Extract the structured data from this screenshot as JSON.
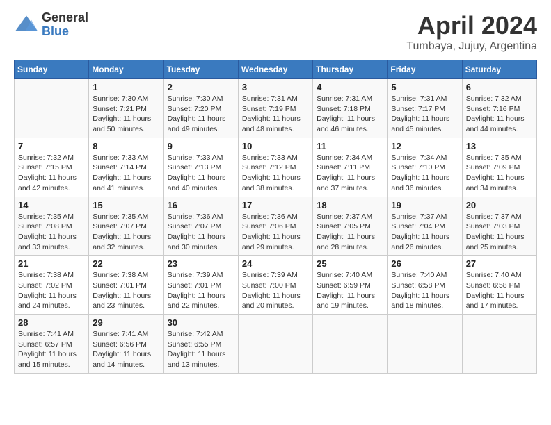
{
  "header": {
    "logo_general": "General",
    "logo_blue": "Blue",
    "month_title": "April 2024",
    "location": "Tumbaya, Jujuy, Argentina"
  },
  "days_of_week": [
    "Sunday",
    "Monday",
    "Tuesday",
    "Wednesday",
    "Thursday",
    "Friday",
    "Saturday"
  ],
  "weeks": [
    [
      {
        "day": "",
        "sunrise": "",
        "sunset": "",
        "daylight": ""
      },
      {
        "day": "1",
        "sunrise": "Sunrise: 7:30 AM",
        "sunset": "Sunset: 7:21 PM",
        "daylight": "Daylight: 11 hours and 50 minutes."
      },
      {
        "day": "2",
        "sunrise": "Sunrise: 7:30 AM",
        "sunset": "Sunset: 7:20 PM",
        "daylight": "Daylight: 11 hours and 49 minutes."
      },
      {
        "day": "3",
        "sunrise": "Sunrise: 7:31 AM",
        "sunset": "Sunset: 7:19 PM",
        "daylight": "Daylight: 11 hours and 48 minutes."
      },
      {
        "day": "4",
        "sunrise": "Sunrise: 7:31 AM",
        "sunset": "Sunset: 7:18 PM",
        "daylight": "Daylight: 11 hours and 46 minutes."
      },
      {
        "day": "5",
        "sunrise": "Sunrise: 7:31 AM",
        "sunset": "Sunset: 7:17 PM",
        "daylight": "Daylight: 11 hours and 45 minutes."
      },
      {
        "day": "6",
        "sunrise": "Sunrise: 7:32 AM",
        "sunset": "Sunset: 7:16 PM",
        "daylight": "Daylight: 11 hours and 44 minutes."
      }
    ],
    [
      {
        "day": "7",
        "sunrise": "Sunrise: 7:32 AM",
        "sunset": "Sunset: 7:15 PM",
        "daylight": "Daylight: 11 hours and 42 minutes."
      },
      {
        "day": "8",
        "sunrise": "Sunrise: 7:33 AM",
        "sunset": "Sunset: 7:14 PM",
        "daylight": "Daylight: 11 hours and 41 minutes."
      },
      {
        "day": "9",
        "sunrise": "Sunrise: 7:33 AM",
        "sunset": "Sunset: 7:13 PM",
        "daylight": "Daylight: 11 hours and 40 minutes."
      },
      {
        "day": "10",
        "sunrise": "Sunrise: 7:33 AM",
        "sunset": "Sunset: 7:12 PM",
        "daylight": "Daylight: 11 hours and 38 minutes."
      },
      {
        "day": "11",
        "sunrise": "Sunrise: 7:34 AM",
        "sunset": "Sunset: 7:11 PM",
        "daylight": "Daylight: 11 hours and 37 minutes."
      },
      {
        "day": "12",
        "sunrise": "Sunrise: 7:34 AM",
        "sunset": "Sunset: 7:10 PM",
        "daylight": "Daylight: 11 hours and 36 minutes."
      },
      {
        "day": "13",
        "sunrise": "Sunrise: 7:35 AM",
        "sunset": "Sunset: 7:09 PM",
        "daylight": "Daylight: 11 hours and 34 minutes."
      }
    ],
    [
      {
        "day": "14",
        "sunrise": "Sunrise: 7:35 AM",
        "sunset": "Sunset: 7:08 PM",
        "daylight": "Daylight: 11 hours and 33 minutes."
      },
      {
        "day": "15",
        "sunrise": "Sunrise: 7:35 AM",
        "sunset": "Sunset: 7:07 PM",
        "daylight": "Daylight: 11 hours and 32 minutes."
      },
      {
        "day": "16",
        "sunrise": "Sunrise: 7:36 AM",
        "sunset": "Sunset: 7:07 PM",
        "daylight": "Daylight: 11 hours and 30 minutes."
      },
      {
        "day": "17",
        "sunrise": "Sunrise: 7:36 AM",
        "sunset": "Sunset: 7:06 PM",
        "daylight": "Daylight: 11 hours and 29 minutes."
      },
      {
        "day": "18",
        "sunrise": "Sunrise: 7:37 AM",
        "sunset": "Sunset: 7:05 PM",
        "daylight": "Daylight: 11 hours and 28 minutes."
      },
      {
        "day": "19",
        "sunrise": "Sunrise: 7:37 AM",
        "sunset": "Sunset: 7:04 PM",
        "daylight": "Daylight: 11 hours and 26 minutes."
      },
      {
        "day": "20",
        "sunrise": "Sunrise: 7:37 AM",
        "sunset": "Sunset: 7:03 PM",
        "daylight": "Daylight: 11 hours and 25 minutes."
      }
    ],
    [
      {
        "day": "21",
        "sunrise": "Sunrise: 7:38 AM",
        "sunset": "Sunset: 7:02 PM",
        "daylight": "Daylight: 11 hours and 24 minutes."
      },
      {
        "day": "22",
        "sunrise": "Sunrise: 7:38 AM",
        "sunset": "Sunset: 7:01 PM",
        "daylight": "Daylight: 11 hours and 23 minutes."
      },
      {
        "day": "23",
        "sunrise": "Sunrise: 7:39 AM",
        "sunset": "Sunset: 7:01 PM",
        "daylight": "Daylight: 11 hours and 22 minutes."
      },
      {
        "day": "24",
        "sunrise": "Sunrise: 7:39 AM",
        "sunset": "Sunset: 7:00 PM",
        "daylight": "Daylight: 11 hours and 20 minutes."
      },
      {
        "day": "25",
        "sunrise": "Sunrise: 7:40 AM",
        "sunset": "Sunset: 6:59 PM",
        "daylight": "Daylight: 11 hours and 19 minutes."
      },
      {
        "day": "26",
        "sunrise": "Sunrise: 7:40 AM",
        "sunset": "Sunset: 6:58 PM",
        "daylight": "Daylight: 11 hours and 18 minutes."
      },
      {
        "day": "27",
        "sunrise": "Sunrise: 7:40 AM",
        "sunset": "Sunset: 6:58 PM",
        "daylight": "Daylight: 11 hours and 17 minutes."
      }
    ],
    [
      {
        "day": "28",
        "sunrise": "Sunrise: 7:41 AM",
        "sunset": "Sunset: 6:57 PM",
        "daylight": "Daylight: 11 hours and 15 minutes."
      },
      {
        "day": "29",
        "sunrise": "Sunrise: 7:41 AM",
        "sunset": "Sunset: 6:56 PM",
        "daylight": "Daylight: 11 hours and 14 minutes."
      },
      {
        "day": "30",
        "sunrise": "Sunrise: 7:42 AM",
        "sunset": "Sunset: 6:55 PM",
        "daylight": "Daylight: 11 hours and 13 minutes."
      },
      {
        "day": "",
        "sunrise": "",
        "sunset": "",
        "daylight": ""
      },
      {
        "day": "",
        "sunrise": "",
        "sunset": "",
        "daylight": ""
      },
      {
        "day": "",
        "sunrise": "",
        "sunset": "",
        "daylight": ""
      },
      {
        "day": "",
        "sunrise": "",
        "sunset": "",
        "daylight": ""
      }
    ]
  ]
}
